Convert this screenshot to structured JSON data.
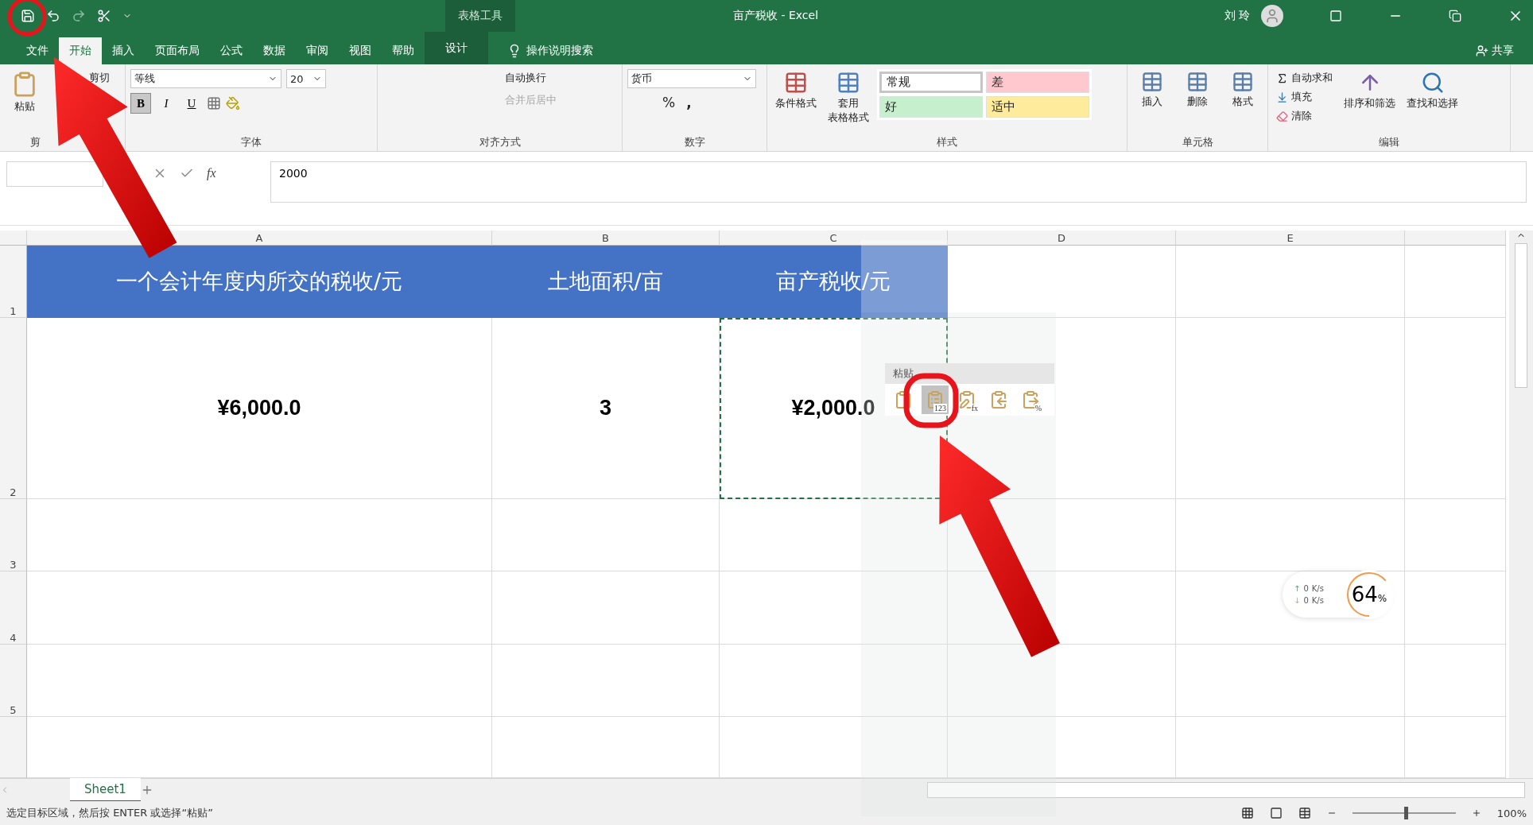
{
  "title_bar": {
    "context_tools": "表格工具",
    "document_title": "亩产税收  -  Excel",
    "user": "刘 玲"
  },
  "ribbon_tabs": [
    {
      "label": "文件",
      "selected": false
    },
    {
      "label": "开始",
      "selected": true
    },
    {
      "label": "插入",
      "selected": false
    },
    {
      "label": "页面布局",
      "selected": false
    },
    {
      "label": "公式",
      "selected": false
    },
    {
      "label": "数据",
      "selected": false
    },
    {
      "label": "审阅",
      "selected": false
    },
    {
      "label": "视图",
      "selected": false
    },
    {
      "label": "帮助",
      "selected": false
    },
    {
      "label": "设计",
      "selected": false,
      "kind": "context"
    }
  ],
  "tell_me": "操作说明搜索",
  "share": "共享",
  "ribbon": {
    "clipboard": {
      "paste": "粘贴",
      "cut": "剪切",
      "label": "剪"
    },
    "font": {
      "font_name": "等线",
      "font_size": "20",
      "bold": "B",
      "italic": "I",
      "underline": "U",
      "label": "字体"
    },
    "alignment": {
      "wrap": "自动换行",
      "merge": {
        "label": "合并后居中",
        "disabled": true
      },
      "label": "对齐方式"
    },
    "number": {
      "format": "货币",
      "percent": "%",
      "comma": ",",
      "label": "数字"
    },
    "styles": {
      "conditional": "条件格式",
      "table_format": [
        "套用",
        "表格格式"
      ],
      "cell_styles": [
        {
          "label": "常规",
          "color": "#ffffff"
        },
        {
          "label": "差",
          "color": "#ffc7ce"
        },
        {
          "label": "好",
          "color": "#c6efce"
        },
        {
          "label": "适中",
          "color": "#ffeb9c"
        }
      ],
      "label": "样式"
    },
    "cells": {
      "buttons": [
        "插入",
        "删除",
        "格式"
      ],
      "label": "单元格"
    },
    "editing": {
      "autosum": "自动求和",
      "fill": "填充",
      "clear": "清除",
      "sort": "排序和筛选",
      "find": "查找和选择",
      "label": "编辑"
    }
  },
  "formula_bar": {
    "fx": "fx",
    "value": "2000"
  },
  "columns": [
    "A",
    "B",
    "C",
    "D",
    "E"
  ],
  "rows": [
    {
      "number": "1",
      "kind": "header",
      "cells": [
        "一个会计年度内所交的税收/元",
        "土地面积/亩",
        "亩产税收/元"
      ]
    },
    {
      "number": "2",
      "kind": "data",
      "cells": [
        "¥6,000.0",
        "3",
        "¥2,000.0"
      ]
    },
    {
      "number": "3",
      "cells": []
    },
    {
      "number": "4",
      "cells": []
    },
    {
      "number": "5",
      "cells": []
    }
  ],
  "paste_options": {
    "title": "粘贴",
    "options": [
      {
        "kind": "paste",
        "selected": false
      },
      {
        "kind": "values",
        "label": "123",
        "selected": true
      },
      {
        "kind": "formula",
        "label": "fx",
        "selected": false
      },
      {
        "kind": "transpose",
        "selected": false
      },
      {
        "kind": "formatting",
        "label": "%",
        "selected": false
      }
    ]
  },
  "sheet_tabs": [
    {
      "label": "Sheet1",
      "selected": true
    }
  ],
  "status_bar": {
    "message": "选定目标区域，然后按 ENTER 或选择“粘贴”",
    "zoom": "100%",
    "zoom_level": {
      "level": 0.5
    }
  },
  "net_widget": {
    "up_arrow": "↑",
    "up": "0",
    "up_unit": "K/s",
    "down_arrow": "↓",
    "down": "0",
    "down_unit": "K/s",
    "percent": "64",
    "percent_sign": "%"
  }
}
